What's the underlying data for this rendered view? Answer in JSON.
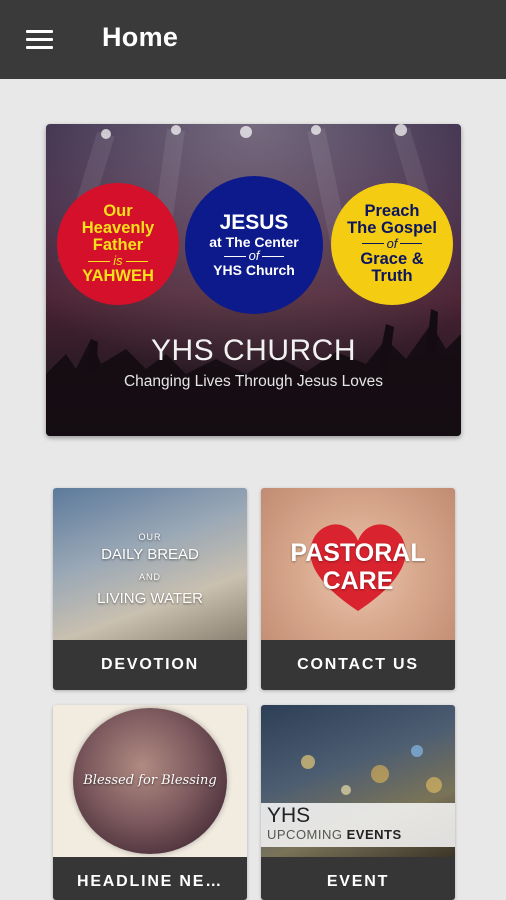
{
  "header": {
    "title": "Home",
    "menu_icon": "hamburger-menu-icon"
  },
  "banner": {
    "circle_left": [
      "Our",
      "Heavenly",
      "Father",
      "is",
      "YAHWEH"
    ],
    "circle_center": [
      "JESUS",
      "at The Center",
      "of",
      "YHS Church"
    ],
    "circle_right": [
      "Preach",
      "The Gospel",
      "of",
      "Grace &",
      "Truth"
    ],
    "church_name": "YHS CHURCH",
    "tagline": "Changing Lives Through Jesus Loves"
  },
  "tiles": [
    {
      "label": "DEVOTION",
      "image_text": [
        "OUR",
        "DAILY BREAD",
        "AND",
        "LIVING WATER"
      ]
    },
    {
      "label": "CONTACT US",
      "image_text": [
        "PASTORAL",
        "CARE"
      ]
    },
    {
      "label": "HEADLINE NE…",
      "image_text": [
        "Blessed for Blessing"
      ]
    },
    {
      "label": "EVENT",
      "image_text": [
        "YHS",
        "UPCOMING",
        "EVENTS"
      ]
    }
  ],
  "colors": {
    "topbar": "#3a3a3a",
    "background": "#e8e8e8",
    "tile_label_bg": "#363636"
  }
}
